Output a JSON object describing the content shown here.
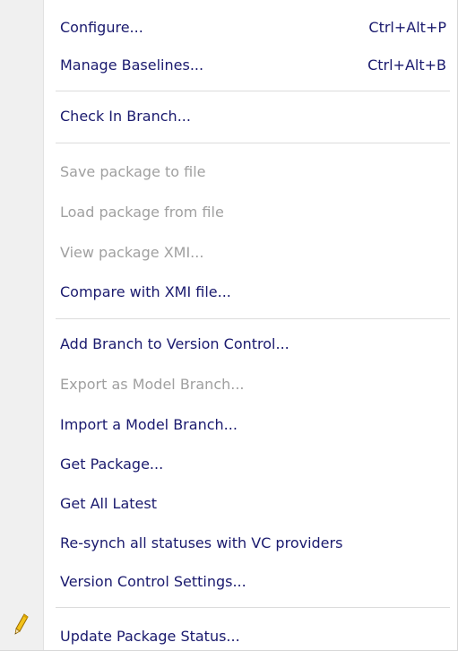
{
  "menu": {
    "items": [
      {
        "label": "Configure...",
        "shortcut": "Ctrl+Alt+P",
        "enabled": true
      },
      {
        "label": "Manage Baselines...",
        "shortcut": "Ctrl+Alt+B",
        "enabled": true
      },
      {
        "label": "Check In Branch...",
        "shortcut": "",
        "enabled": true
      },
      {
        "label": "Save package to file",
        "shortcut": "",
        "enabled": false
      },
      {
        "label": "Load package from file",
        "shortcut": "",
        "enabled": false
      },
      {
        "label": "View package XMI...",
        "shortcut": "",
        "enabled": false
      },
      {
        "label": "Compare with XMI file...",
        "shortcut": "",
        "enabled": true
      },
      {
        "label": "Add Branch to Version Control...",
        "shortcut": "",
        "enabled": true
      },
      {
        "label": "Export as Model Branch...",
        "shortcut": "",
        "enabled": false
      },
      {
        "label": "Import a Model Branch...",
        "shortcut": "",
        "enabled": true
      },
      {
        "label": "Get Package...",
        "shortcut": "",
        "enabled": true
      },
      {
        "label": "Get All Latest",
        "shortcut": "",
        "enabled": true
      },
      {
        "label": "Re-synch all statuses with VC providers",
        "shortcut": "",
        "enabled": true
      },
      {
        "label": "Version Control Settings...",
        "shortcut": "",
        "enabled": true
      },
      {
        "label": "Update Package Status...",
        "shortcut": "",
        "enabled": true,
        "icon": "pencil-icon"
      }
    ]
  },
  "colors": {
    "text": "#1a1a6e",
    "disabled_text": "#a0a0a0",
    "gutter": "#f0f0f0",
    "separator": "#dcdcdc"
  }
}
